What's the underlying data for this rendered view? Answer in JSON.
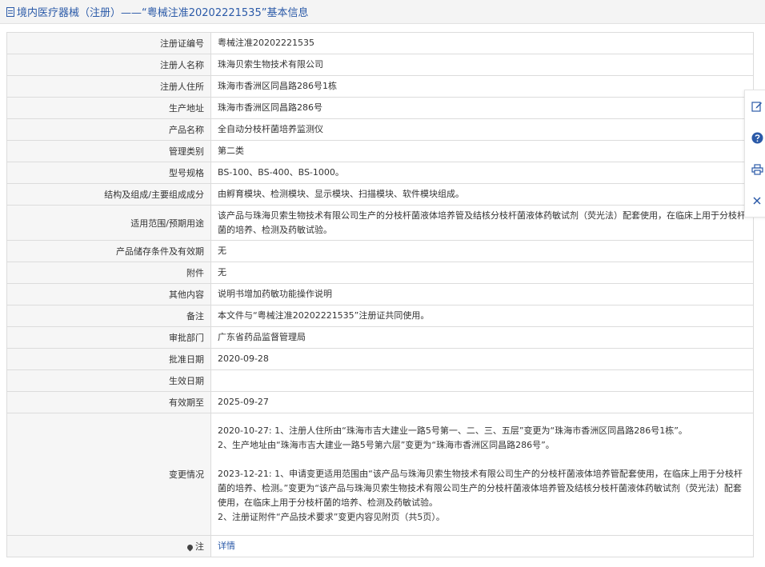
{
  "header": {
    "title": "境内医疗器械（注册）——“粤械注准20202221535”基本信息",
    "accent_color": "#2b5aa8"
  },
  "rows": [
    {
      "label": "注册证编号",
      "value": "粤械注准20202221535"
    },
    {
      "label": "注册人名称",
      "value": "珠海贝索生物技术有限公司"
    },
    {
      "label": "注册人住所",
      "value": "珠海市香洲区同昌路286号1栋"
    },
    {
      "label": "生产地址",
      "value": "珠海市香洲区同昌路286号"
    },
    {
      "label": "产品名称",
      "value": "全自动分枝杆菌培养监测仪"
    },
    {
      "label": "管理类别",
      "value": "第二类"
    },
    {
      "label": "型号规格",
      "value": "BS-100、BS-400、BS-1000。"
    },
    {
      "label": "结构及组成/主要组成成分",
      "value": "由孵育模块、检测模块、显示模块、扫描模块、软件模块组成。"
    },
    {
      "label": "适用范围/预期用途",
      "value": "该产品与珠海贝索生物技术有限公司生产的分枝杆菌液体培养管及结核分枝杆菌液体药敏试剂（荧光法）配套使用，在临床上用于分枝杆菌的培养、检测及药敏试验。"
    },
    {
      "label": "产品储存条件及有效期",
      "value": "无"
    },
    {
      "label": "附件",
      "value": "无"
    },
    {
      "label": "其他内容",
      "value": "说明书增加药敏功能操作说明"
    },
    {
      "label": "备注",
      "value": "本文件与“粤械注准20202221535”注册证共同使用。"
    },
    {
      "label": "审批部门",
      "value": "广东省药品监督管理局"
    },
    {
      "label": "批准日期",
      "value": "2020-09-28"
    },
    {
      "label": "生效日期",
      "value": ""
    },
    {
      "label": "有效期至",
      "value": "2025-09-27"
    }
  ],
  "change": {
    "label": "变更情况",
    "first_block": "2020-10-27: 1、注册人住所由“珠海市吉大建业一路5号第一、二、三、五层”变更为“珠海市香洲区同昌路286号1栋”。\n2、生产地址由“珠海市吉大建业一路5号第六层”变更为“珠海市香洲区同昌路286号”。",
    "second_block": "2023-12-21: 1、申请变更适用范围由“该产品与珠海贝索生物技术有限公司生产的分枝杆菌液体培养管配套使用，在临床上用于分枝杆菌的培养、检测。”变更为“该产品与珠海贝索生物技术有限公司生产的分枝杆菌液体培养管及结核分枝杆菌液体药敏试剂（荧光法）配套使用，在临床上用于分枝杆菌的培养、检测及药敏试验。\n2、注册证附件“产品技术要求”变更内容见附页（共5页）。"
  },
  "note": {
    "label": "注",
    "icon": "pin-icon",
    "link_text": "详情"
  },
  "side_tools": [
    "edit-icon",
    "help-icon",
    "print-icon",
    "close-icon"
  ]
}
